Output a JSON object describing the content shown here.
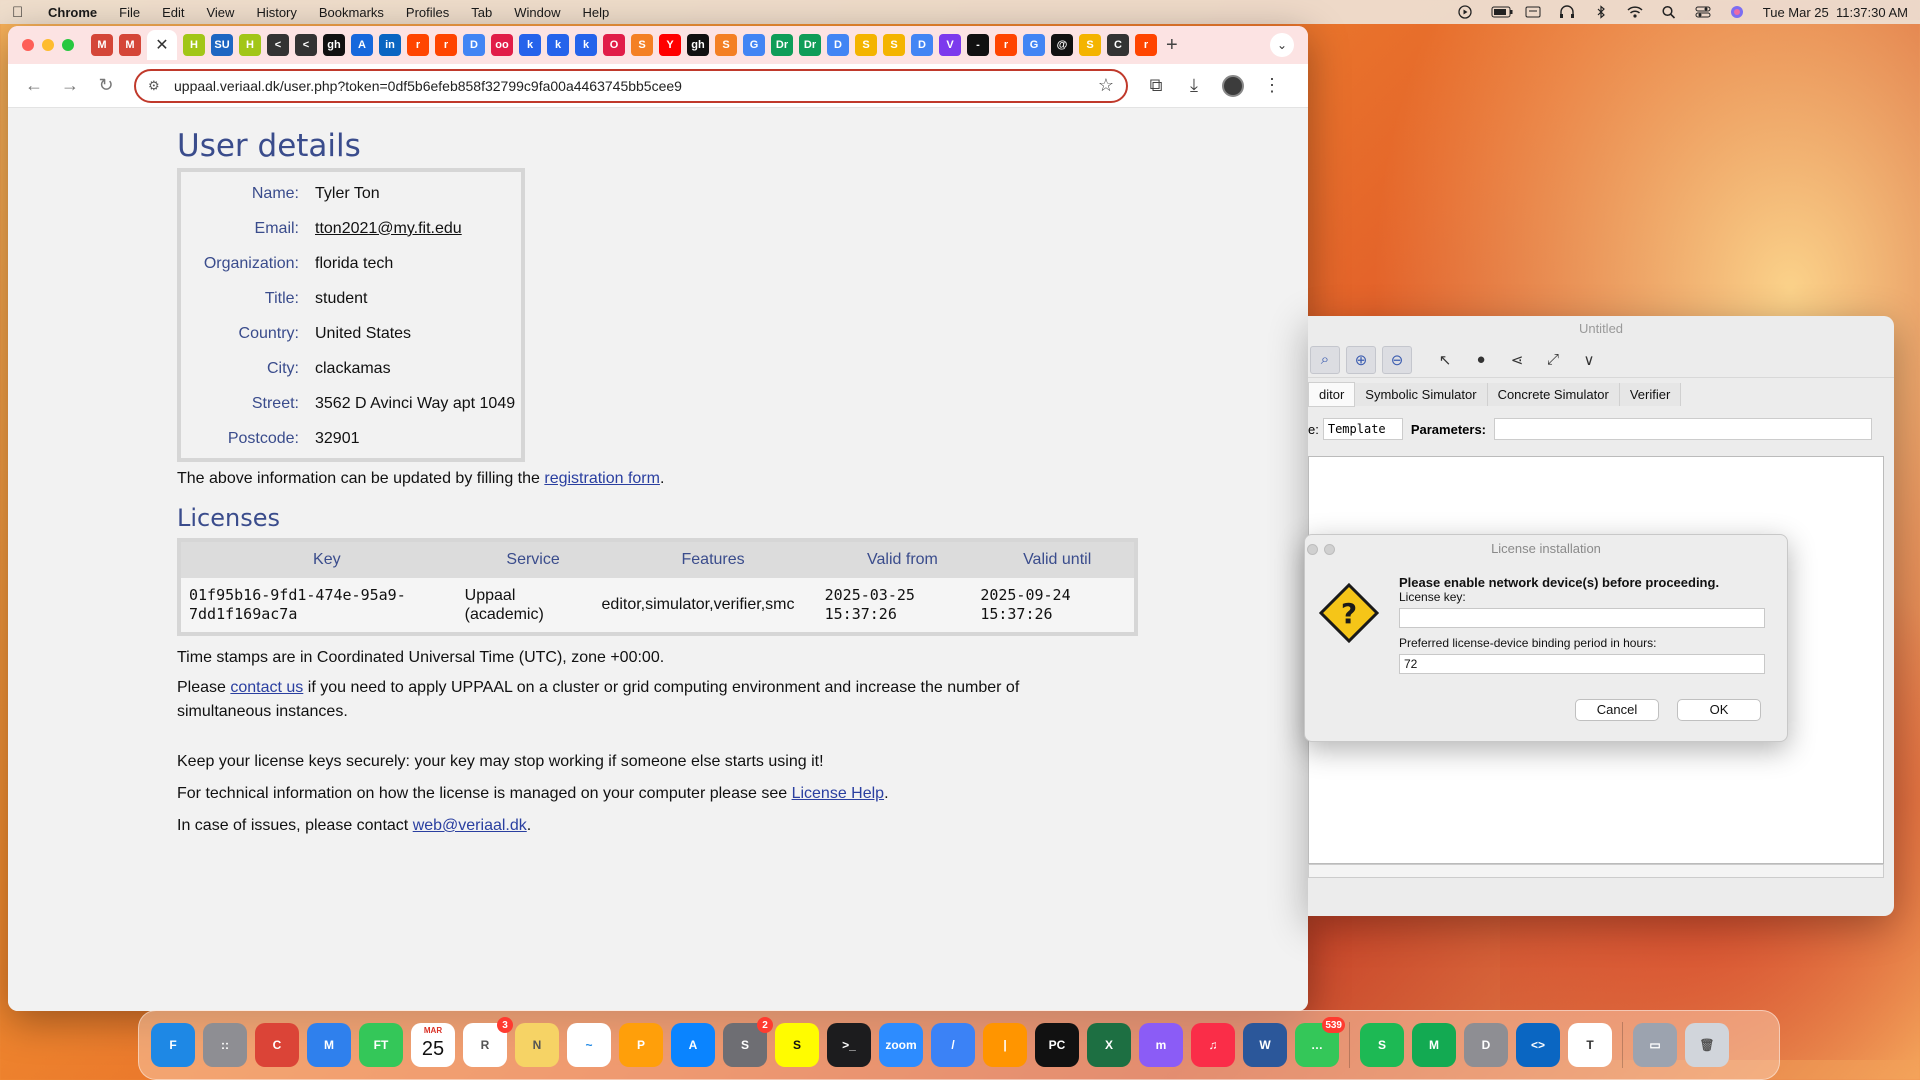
{
  "menubar": {
    "app": "Chrome",
    "items": [
      "File",
      "Edit",
      "View",
      "History",
      "Bookmarks",
      "Profiles",
      "Tab",
      "Window",
      "Help"
    ],
    "clock": "Tue Mar 25  11:37:30 AM"
  },
  "browser": {
    "url": "uppaal.veriaal.dk/user.php?token=0df5b6efeb858f32799c9fa00a4463745bb5cee9",
    "tab_favicons": [
      {
        "label": "M",
        "color": "#d44638"
      },
      {
        "label": "M",
        "color": "#d44638"
      },
      {
        "label": "H",
        "color": "#a2c617"
      },
      {
        "label": "SU",
        "color": "#1e66c2"
      },
      {
        "label": "H",
        "color": "#a2c617"
      },
      {
        "label": "<",
        "color": "#333333"
      },
      {
        "label": "<",
        "color": "#333333"
      },
      {
        "label": "gh",
        "color": "#111111"
      },
      {
        "label": "A",
        "color": "#1668dc"
      },
      {
        "label": "in",
        "color": "#0a66c2"
      },
      {
        "label": "r",
        "color": "#ff4500"
      },
      {
        "label": "r",
        "color": "#ff4500"
      },
      {
        "label": "D",
        "color": "#4285f4"
      },
      {
        "label": "oo",
        "color": "#e11d48"
      },
      {
        "label": "k",
        "color": "#2563eb"
      },
      {
        "label": "k",
        "color": "#2563eb"
      },
      {
        "label": "k",
        "color": "#2563eb"
      },
      {
        "label": "O",
        "color": "#e11d48"
      },
      {
        "label": "S",
        "color": "#f48024"
      },
      {
        "label": "Y",
        "color": "#ff0000"
      },
      {
        "label": "gh",
        "color": "#111111"
      },
      {
        "label": "S",
        "color": "#f48024"
      },
      {
        "label": "G",
        "color": "#4285f4"
      },
      {
        "label": "Dr",
        "color": "#0f9d58"
      },
      {
        "label": "Dr",
        "color": "#0f9d58"
      },
      {
        "label": "D",
        "color": "#4285f4"
      },
      {
        "label": "S",
        "color": "#f4b400"
      },
      {
        "label": "S",
        "color": "#f4b400"
      },
      {
        "label": "D",
        "color": "#4285f4"
      },
      {
        "label": "V",
        "color": "#7c3aed"
      },
      {
        "label": "-",
        "color": "#111111"
      },
      {
        "label": "r",
        "color": "#ff4500"
      },
      {
        "label": "G",
        "color": "#4285f4"
      },
      {
        "label": "@",
        "color": "#111111"
      },
      {
        "label": "S",
        "color": "#f4b400"
      },
      {
        "label": "C",
        "color": "#333333"
      },
      {
        "label": "r",
        "color": "#ff4500"
      }
    ]
  },
  "user": {
    "heading": "User details",
    "fields": [
      {
        "label": "Name:",
        "value": "Tyler Ton"
      },
      {
        "label": "Email:",
        "value": "tton2021@my.fit.edu",
        "link": true
      },
      {
        "label": "Organization:",
        "value": "florida tech"
      },
      {
        "label": "Title:",
        "value": "student"
      },
      {
        "label": "Country:",
        "value": "United States"
      },
      {
        "label": "City:",
        "value": "clackamas"
      },
      {
        "label": "Street:",
        "value": "3562 D Avinci Way apt 1049"
      },
      {
        "label": "Postcode:",
        "value": "32901"
      }
    ],
    "update_prefix": "The above information can be updated by filling the ",
    "update_link": "registration form",
    "update_suffix": "."
  },
  "licenses": {
    "heading": "Licenses",
    "columns": [
      "Key",
      "Service",
      "Features",
      "Valid from",
      "Valid until"
    ],
    "rows": [
      {
        "key_line1": "01f95b16-9fd1-474e-95a9-",
        "key_line2": "7dd1f169ac7a",
        "service_line1": "Uppaal",
        "service_line2": "(academic)",
        "features": "editor,simulator,verifier,smc",
        "from_line1": "2025-03-25",
        "from_line2": "15:37:26",
        "until_line1": "2025-09-24",
        "until_line2": "15:37:26"
      }
    ],
    "timestamps_note": "Time stamps are in Coordinated Universal Time (UTC), zone +00:00.",
    "contact_prefix": "Please ",
    "contact_link": "contact us",
    "contact_suffix": " if you need to apply UPPAAL on a cluster or grid computing environment and increase the number of simultaneous instances.",
    "secure_note": "Keep your license keys securely: your key may stop working if someone else starts using it!",
    "help_prefix": "For technical information on how the license is managed on your computer please see ",
    "help_link": "License Help",
    "help_suffix": ".",
    "issues_prefix": "In case of issues, please contact ",
    "issues_link": "web@veriaal.dk",
    "issues_suffix": "."
  },
  "uppaal": {
    "window_title": "Untitled",
    "tabs": [
      "ditor",
      "Symbolic Simulator",
      "Concrete Simulator",
      "Verifier"
    ],
    "name_label": "e:",
    "name_value": "Template",
    "params_label": "Parameters:"
  },
  "dialog": {
    "title": "License installation",
    "message": "Please enable network device(s) before proceeding.",
    "key_label": "License key:",
    "key_value": "",
    "period_label": "Preferred license-device binding period in hours:",
    "period_value": "72",
    "cancel": "Cancel",
    "ok": "OK"
  },
  "dock": {
    "apps": [
      {
        "name": "finder-icon",
        "label": "F",
        "color": "#1e88e5"
      },
      {
        "name": "launchpad-icon",
        "label": "::",
        "color": "#8e8e93"
      },
      {
        "name": "chrome-icon",
        "label": "C",
        "color": "#db4437"
      },
      {
        "name": "mail-icon",
        "label": "M",
        "color": "#2f80ed"
      },
      {
        "name": "facetime-icon",
        "label": "FT",
        "color": "#34c759"
      },
      {
        "name": "calendar-icon",
        "label": "25",
        "color": "#ffffff",
        "text": "#d93025",
        "month": "MAR"
      },
      {
        "name": "reminders-icon",
        "label": "R",
        "color": "#ffffff",
        "text": "#555555",
        "badge": "3"
      },
      {
        "name": "notes-icon",
        "label": "N",
        "color": "#f6d365",
        "text": "#555555"
      },
      {
        "name": "freeform-icon",
        "label": "~",
        "color": "#ffffff",
        "text": "#1e88e5"
      },
      {
        "name": "photos-icon",
        "label": "P",
        "color": "#ff9f0a"
      },
      {
        "name": "appstore-icon",
        "label": "A",
        "color": "#0a84ff"
      },
      {
        "name": "system-settings-icon",
        "label": "S",
        "color": "#6e6e73",
        "badge": "2"
      },
      {
        "name": "snapchat-icon",
        "label": "S",
        "color": "#fffc00",
        "text": "#111111"
      },
      {
        "name": "terminal-icon",
        "label": ">_",
        "color": "#1c1c1e"
      },
      {
        "name": "zoom-icon",
        "label": "zoom",
        "color": "#2d8cff"
      },
      {
        "name": "pencil-app-icon",
        "label": "/",
        "color": "#3b82f6"
      },
      {
        "name": "pages-icon",
        "label": "|",
        "color": "#ff9500"
      },
      {
        "name": "pycharm-icon",
        "label": "PC",
        "color": "#111111"
      },
      {
        "name": "excel-icon",
        "label": "X",
        "color": "#1d6f42"
      },
      {
        "name": "messenger-icon",
        "label": "m",
        "color": "#8b5cf6"
      },
      {
        "name": "music-icon",
        "label": "♫",
        "color": "#fa2d48"
      },
      {
        "name": "word-icon",
        "label": "W",
        "color": "#2b579a"
      },
      {
        "name": "messages-icon",
        "label": "…",
        "color": "#34c759",
        "badge": "539"
      },
      {
        "name": "spotify-icon",
        "label": "S",
        "color": "#1db954"
      },
      {
        "name": "mongodb-icon",
        "label": "M",
        "color": "#13aa52"
      },
      {
        "name": "drive-app-icon",
        "label": "D",
        "color": "#8e8e93"
      },
      {
        "name": "vscode-icon",
        "label": "<>",
        "color": "#0a66c2"
      },
      {
        "name": "time-machine-icon",
        "label": "T",
        "color": "#ffffff",
        "text": "#333333"
      },
      {
        "name": "downloads-folder-icon",
        "label": "▭",
        "color": "#9ca3af"
      },
      {
        "name": "trash-icon",
        "label": "🗑",
        "color": "#d1d5db",
        "text": "#555555"
      }
    ]
  }
}
